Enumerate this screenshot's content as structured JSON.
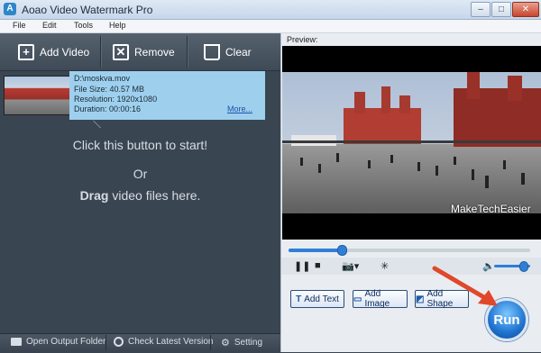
{
  "window": {
    "icon_letter": "A",
    "title": "Aoao Video Watermark Pro",
    "controls": {
      "minimize": "–",
      "maximize": "□",
      "close": "✕"
    }
  },
  "menu": [
    "File",
    "Edit",
    "Tools",
    "Help"
  ],
  "toolbar": {
    "add_video": "Add Video",
    "remove": "Remove",
    "clear": "Clear"
  },
  "video_item": {
    "path": "D:\\moskva.mov",
    "file_size": "File Size: 40.57 MB",
    "resolution": "Resolution: 1920x1080",
    "duration": "Duration: 00:00:16",
    "more": "More..."
  },
  "hints": {
    "line1": "Click this button to start!",
    "line2": "Or",
    "line3_bold": "Drag",
    "line3_rest": " video files here."
  },
  "bottom": {
    "open_folder": "Open Output Folder",
    "check_version": "Check Latest Version",
    "setting": "Setting"
  },
  "preview": {
    "label": "Preview:",
    "watermark": "MakeTechEasier",
    "progress": 0.22,
    "volume": 0.8
  },
  "add_buttons": {
    "text": "Add Text",
    "image": "Add Image",
    "shape": "Add Shape"
  },
  "run_label": "Run",
  "colors": {
    "panel": "#3a4552",
    "accent": "#2f7fd6",
    "selection": "#9ed0ee",
    "arrow": "#e0472b"
  }
}
